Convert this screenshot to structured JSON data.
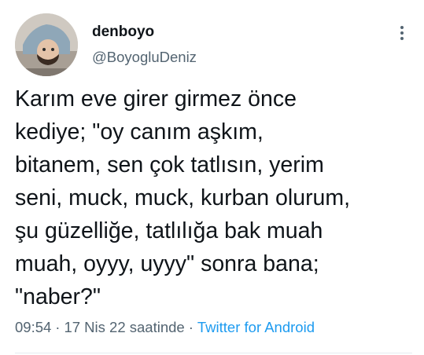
{
  "author": {
    "display_name": "denboyo",
    "handle": "@BoyogluDeniz"
  },
  "tweet": {
    "text": "Karım eve girer girmez önce\nkediye; \"oy canım aşkım,\nbitanem, sen çok tatlısın, yerim\nseni, muck, muck, kurban olurum,\nşu güzelliğe, tatlılığa bak muah\nmuah, oyyy, uyyy\" sonra bana;\n\"naber?\""
  },
  "meta": {
    "time": "09:54",
    "separator": "·",
    "date": "17 Nis 22 saatinde",
    "source": "Twitter for Android"
  },
  "icons": {
    "more": "more-vertical-icon"
  },
  "colors": {
    "text": "#0f1419",
    "secondary": "#536471",
    "link": "#1d9bf0"
  }
}
